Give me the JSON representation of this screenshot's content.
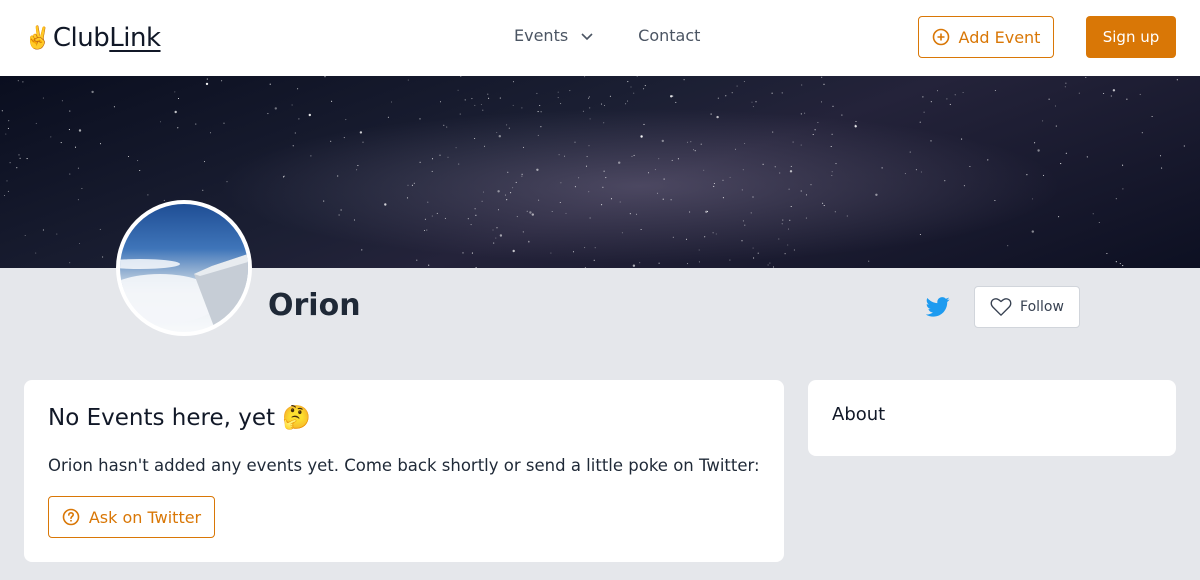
{
  "nav": {
    "logo_emoji": "✌️",
    "logo_text_1": "Club",
    "logo_text_2": "Link",
    "events_label": "Events",
    "contact_label": "Contact",
    "add_event_label": "Add Event",
    "signup_label": "Sign up",
    "accent_color": "#d97706"
  },
  "club": {
    "name": "Orion",
    "follow_label": "Follow"
  },
  "events_card": {
    "title": "No Events here, yet 🤔",
    "message": "Orion hasn't added any events yet. Come back shortly or send a little poke on Twitter:",
    "ask_label": "Ask on Twitter"
  },
  "about_card": {
    "title": "About"
  }
}
